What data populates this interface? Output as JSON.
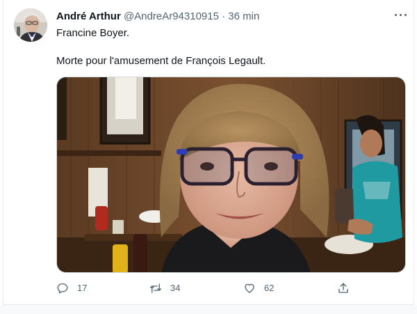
{
  "tweet": {
    "author_name": "André Arthur",
    "handle": "@AndreAr94310915",
    "separator": "·",
    "time": "36 min",
    "text_line1": "Francine Boyer.",
    "text_line2": "Morte pour l'amusement de François Legault."
  },
  "actions": {
    "reply_count": "17",
    "retweet_count": "34",
    "like_count": "62"
  },
  "icons": {
    "more": "more-horizontal-icon",
    "reply": "reply-bubble-icon",
    "retweet": "retweet-arrows-icon",
    "like": "heart-icon",
    "share": "share-upload-icon"
  },
  "colors": {
    "text_primary": "#0f1419",
    "text_secondary": "#536471",
    "border": "#e6ecf0"
  }
}
